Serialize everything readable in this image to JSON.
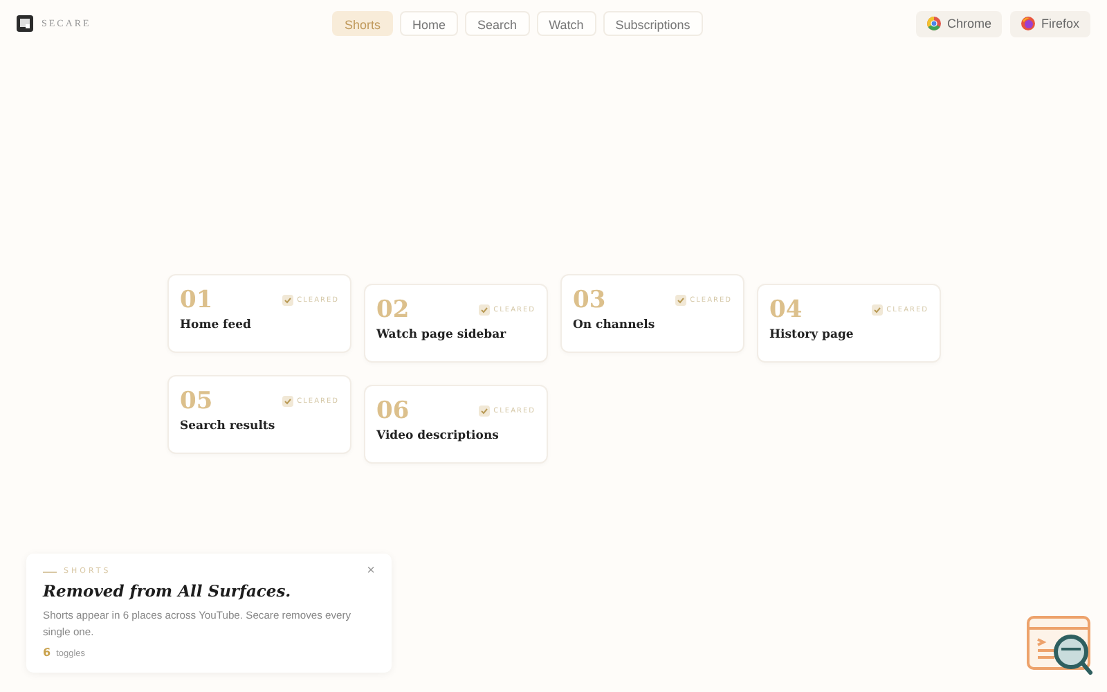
{
  "brand": "SECARE",
  "nav": [
    {
      "label": "Shorts",
      "selected": true
    },
    {
      "label": "Home",
      "selected": false
    },
    {
      "label": "Search",
      "selected": false
    },
    {
      "label": "Watch",
      "selected": false
    },
    {
      "label": "Subscriptions",
      "selected": false
    }
  ],
  "browsers": [
    {
      "label": "Chrome",
      "kind": "chrome"
    },
    {
      "label": "Firefox",
      "kind": "firefox"
    }
  ],
  "cards": [
    {
      "number": "01",
      "status": "CLEARED",
      "title": "Home feed"
    },
    {
      "number": "02",
      "status": "CLEARED",
      "title": "Watch page sidebar"
    },
    {
      "number": "03",
      "status": "CLEARED",
      "title": "On channels"
    },
    {
      "number": "04",
      "status": "CLEARED",
      "title": "History page"
    },
    {
      "number": "05",
      "status": "CLEARED",
      "title": "Search results"
    },
    {
      "number": "06",
      "status": "CLEARED",
      "title": "Video descriptions"
    }
  ],
  "info": {
    "eyebrow": "SHORTS",
    "heading": "Removed from All Surfaces.",
    "body": "Shorts appear in 6 places across YouTube. Secare removes every single one.",
    "count": "6",
    "count_label": "toggles",
    "close": "×"
  }
}
